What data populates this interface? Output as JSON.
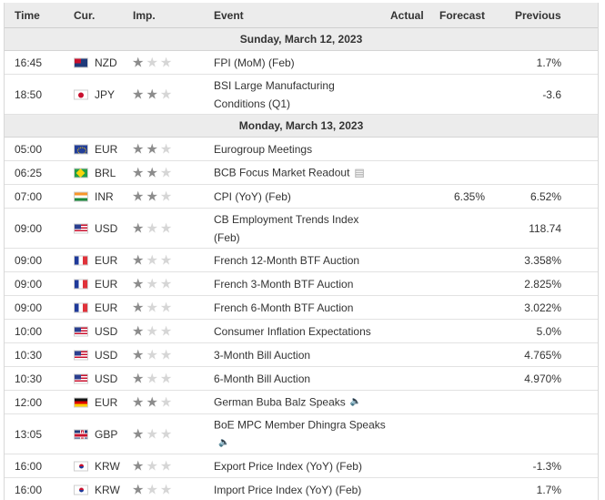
{
  "header": {
    "time": "Time",
    "currency": "Cur.",
    "importance": "Imp.",
    "event": "Event",
    "actual": "Actual",
    "forecast": "Forecast",
    "previous": "Previous"
  },
  "groups": [
    {
      "date": "Sunday, March 12, 2023",
      "rows": [
        {
          "time": "16:45",
          "flag": "nz-flag-icon",
          "currency": "NZD",
          "importance": 1,
          "event": "FPI (MoM) (Feb)",
          "actual": "",
          "forecast": "",
          "previous": "1.7%",
          "event_icon": ""
        },
        {
          "time": "18:50",
          "flag": "jp-flag-icon",
          "currency": "JPY",
          "importance": 2,
          "event": "BSI Large Manufacturing Conditions (Q1)",
          "actual": "",
          "forecast": "",
          "previous": "-3.6",
          "event_icon": ""
        }
      ]
    },
    {
      "date": "Monday, March 13, 2023",
      "rows": [
        {
          "time": "05:00",
          "flag": "eu-flag-icon",
          "currency": "EUR",
          "importance": 2,
          "event": "Eurogroup Meetings",
          "actual": "",
          "forecast": "",
          "previous": "",
          "event_icon": ""
        },
        {
          "time": "06:25",
          "flag": "br-flag-icon",
          "currency": "BRL",
          "importance": 2,
          "event": "BCB Focus Market Readout",
          "actual": "",
          "forecast": "",
          "previous": "",
          "event_icon": "report-icon"
        },
        {
          "time": "07:00",
          "flag": "in-flag-icon",
          "currency": "INR",
          "importance": 2,
          "event": "CPI (YoY) (Feb)",
          "actual": "",
          "forecast": "6.35%",
          "previous": "6.52%",
          "event_icon": ""
        },
        {
          "time": "09:00",
          "flag": "us-flag-icon",
          "currency": "USD",
          "importance": 1,
          "event": "CB Employment Trends Index (Feb)",
          "actual": "",
          "forecast": "",
          "previous": "118.74",
          "event_icon": ""
        },
        {
          "time": "09:00",
          "flag": "fr-flag-icon",
          "currency": "EUR",
          "importance": 1,
          "event": "French 12-Month BTF Auction",
          "actual": "",
          "forecast": "",
          "previous": "3.358%",
          "event_icon": ""
        },
        {
          "time": "09:00",
          "flag": "fr-flag-icon",
          "currency": "EUR",
          "importance": 1,
          "event": "French 3-Month BTF Auction",
          "actual": "",
          "forecast": "",
          "previous": "2.825%",
          "event_icon": ""
        },
        {
          "time": "09:00",
          "flag": "fr-flag-icon",
          "currency": "EUR",
          "importance": 1,
          "event": "French 6-Month BTF Auction",
          "actual": "",
          "forecast": "",
          "previous": "3.022%",
          "event_icon": ""
        },
        {
          "time": "10:00",
          "flag": "us-flag-icon",
          "currency": "USD",
          "importance": 1,
          "event": "Consumer Inflation Expectations",
          "actual": "",
          "forecast": "",
          "previous": "5.0%",
          "event_icon": ""
        },
        {
          "time": "10:30",
          "flag": "us-flag-icon",
          "currency": "USD",
          "importance": 1,
          "event": "3-Month Bill Auction",
          "actual": "",
          "forecast": "",
          "previous": "4.765%",
          "event_icon": ""
        },
        {
          "time": "10:30",
          "flag": "us-flag-icon",
          "currency": "USD",
          "importance": 1,
          "event": "6-Month Bill Auction",
          "actual": "",
          "forecast": "",
          "previous": "4.970%",
          "event_icon": ""
        },
        {
          "time": "12:00",
          "flag": "de-flag-icon",
          "currency": "EUR",
          "importance": 2,
          "event": "German Buba Balz Speaks",
          "actual": "",
          "forecast": "",
          "previous": "",
          "event_icon": "speaker-icon"
        },
        {
          "time": "13:05",
          "flag": "gb-flag-icon",
          "currency": "GBP",
          "importance": 1,
          "event": "BoE MPC Member Dhingra Speaks",
          "actual": "",
          "forecast": "",
          "previous": "",
          "event_icon": "speaker-icon"
        },
        {
          "time": "16:00",
          "flag": "kr-flag-icon",
          "currency": "KRW",
          "importance": 1,
          "event": "Export Price Index (YoY) (Feb)",
          "actual": "",
          "forecast": "",
          "previous": "-1.3%",
          "event_icon": ""
        },
        {
          "time": "16:00",
          "flag": "kr-flag-icon",
          "currency": "KRW",
          "importance": 1,
          "event": "Import Price Index (YoY) (Feb)",
          "actual": "",
          "forecast": "",
          "previous": "1.7%",
          "event_icon": ""
        }
      ]
    }
  ]
}
